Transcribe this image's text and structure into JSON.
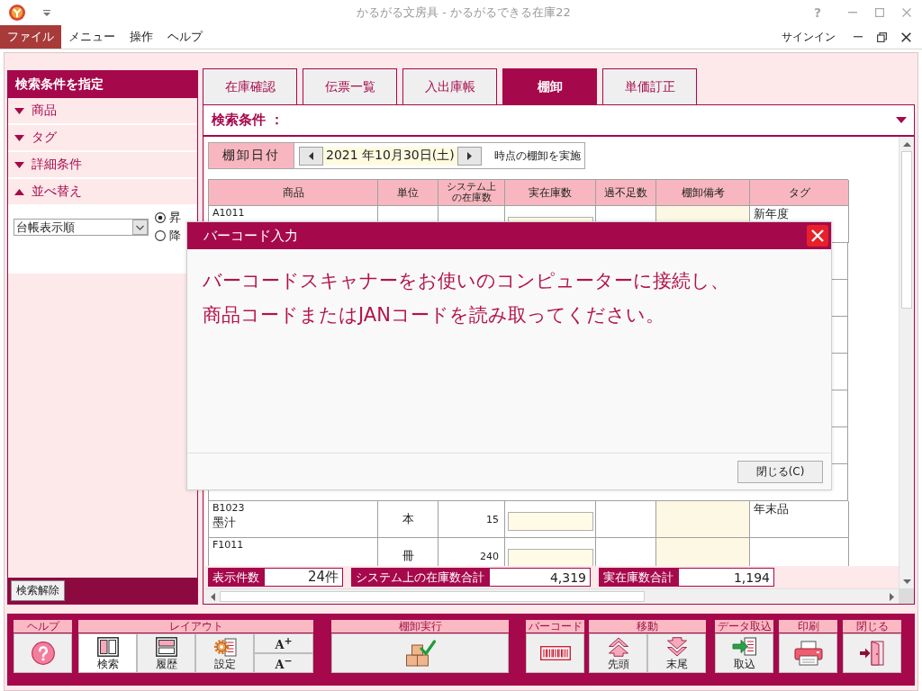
{
  "window": {
    "title": "かるがる文房具 - かるがるできる在庫22",
    "help_button": "?"
  },
  "menu": {
    "items": [
      {
        "label": "ファイル",
        "selected": true
      },
      {
        "label": "メニュー",
        "selected": false
      },
      {
        "label": "操作",
        "selected": false
      },
      {
        "label": "ヘルプ",
        "selected": false
      }
    ],
    "account": "サインイン"
  },
  "sidebar": {
    "title": "検索条件を指定",
    "sections": [
      {
        "label": "商品",
        "expanded": false
      },
      {
        "label": "タグ",
        "expanded": false
      },
      {
        "label": "詳細条件",
        "expanded": false
      },
      {
        "label": "並べ替え",
        "expanded": true
      }
    ],
    "sort": {
      "field": "台帳表示順",
      "options": [
        {
          "label": "昇",
          "selected": true
        },
        {
          "label": "降",
          "selected": false
        }
      ]
    },
    "clear_button": "検索解除"
  },
  "tabs": [
    {
      "label": "在庫確認",
      "selected": false
    },
    {
      "label": "伝票一覧",
      "selected": false
    },
    {
      "label": "入出庫帳",
      "selected": false
    },
    {
      "label": "棚卸",
      "selected": true
    },
    {
      "label": "単価訂正",
      "selected": false
    }
  ],
  "search_bar": {
    "label": "検索条件 ："
  },
  "stocktake_date": {
    "label": "棚卸日付",
    "value": "2021 年10月30日(土)",
    "suffix": "時点の棚卸を実施"
  },
  "table": {
    "columns": [
      "商品",
      "単位",
      "システム上の在庫数",
      "実在庫数",
      "過不足数",
      "棚卸備考",
      "タグ"
    ],
    "rows": [
      {
        "code": "A1011",
        "tag": "新年度"
      },
      {
        "code": "B1023",
        "name": "墨汁",
        "unit": "本",
        "system_stock": "15",
        "tag": "年末品"
      },
      {
        "code": "F1011",
        "unit": "冊",
        "system_stock": "240"
      }
    ]
  },
  "summary": [
    {
      "label": "表示件数",
      "value": "24件"
    },
    {
      "label": "システム上の在庫数合計",
      "value": "4,319"
    },
    {
      "label": "実在庫数合計",
      "value": "1,194"
    }
  ],
  "dialog": {
    "title": "バーコード入力",
    "message": "バーコードスキャナーをお使いのコンピューターに接続し、商品コードまたはJANコードを読み取ってください。",
    "button": "閉じる(C)"
  },
  "toolbar": [
    {
      "title": "ヘルプ",
      "buttons": [
        {
          "kind": "help"
        }
      ]
    },
    {
      "title": "レイアウト",
      "buttons": [
        {
          "kind": "search-layout",
          "label": "検索",
          "selected": true
        },
        {
          "kind": "history-layout",
          "label": "履歴",
          "selected": false
        },
        {
          "kind": "settings",
          "label": "設定",
          "selected": false
        }
      ],
      "font_size": [
        "A$^{+}$",
        "A$^{−}$"
      ]
    },
    {
      "title": "棚卸実行",
      "buttons": [
        {
          "kind": "stocktake"
        }
      ]
    },
    {
      "title": "バーコード",
      "buttons": [
        {
          "kind": "barcode"
        }
      ]
    },
    {
      "title": "移動",
      "buttons": [
        {
          "kind": "first",
          "label": "先頭"
        },
        {
          "kind": "last",
          "label": "末尾"
        }
      ]
    },
    {
      "title": "データ取込",
      "buttons": [
        {
          "kind": "import",
          "label": "取込"
        }
      ]
    },
    {
      "title": "印刷",
      "buttons": [
        {
          "kind": "print"
        }
      ]
    },
    {
      "title": "閉じる",
      "buttons": [
        {
          "kind": "exit"
        }
      ]
    }
  ]
}
